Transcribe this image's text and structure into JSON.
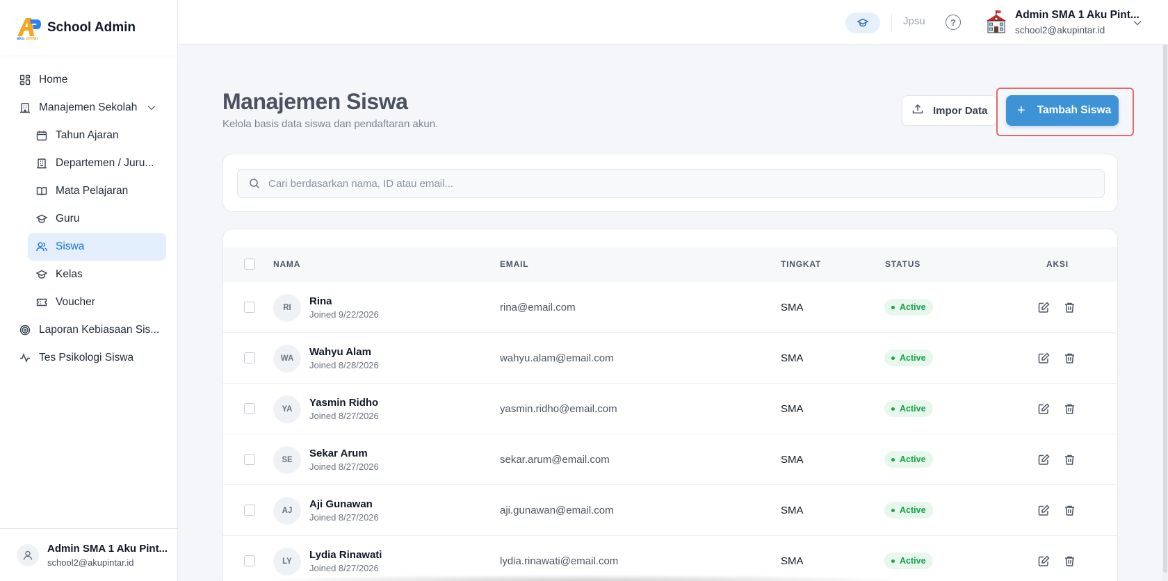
{
  "brand": {
    "title": "School Admin",
    "logo_text": "akupintar"
  },
  "sidebar": {
    "items": [
      {
        "label": "Home",
        "icon": "grid-icon",
        "level": "top"
      },
      {
        "label": "Manajemen Sekolah",
        "icon": "building-icon",
        "level": "top",
        "expandable": true
      },
      {
        "label": "Tahun Ajaran",
        "icon": "calendar-icon",
        "level": "sub"
      },
      {
        "label": "Departemen / Juru...",
        "icon": "department-icon",
        "level": "sub"
      },
      {
        "label": "Mata Pelajaran",
        "icon": "book-icon",
        "level": "sub"
      },
      {
        "label": "Guru",
        "icon": "graduation-cap-icon",
        "level": "sub"
      },
      {
        "label": "Siswa",
        "icon": "users-icon",
        "level": "sub",
        "active": true
      },
      {
        "label": "Kelas",
        "icon": "graduation-cap-icon",
        "level": "sub"
      },
      {
        "label": "Voucher",
        "icon": "ticket-icon",
        "level": "sub"
      },
      {
        "label": "Laporan Kebiasaan Sis...",
        "icon": "target-icon",
        "level": "top"
      },
      {
        "label": "Tes Psikologi Siswa",
        "icon": "activity-icon",
        "level": "top"
      }
    ],
    "footer": {
      "name": "Admin SMA 1 Aku Pint...",
      "email": "school2@akupintar.id"
    }
  },
  "topbar": {
    "language": "Jpsu",
    "help": "?",
    "user_name": "Admin SMA 1 Aku Pint...",
    "user_email": "school2@akupintar.id"
  },
  "main": {
    "title": "Manajemen Siswa",
    "subtitle": "Kelola basis data siswa dan pendaftaran akun.",
    "import_label": "Impor Data",
    "add_label": "Tambah Siswa",
    "search_placeholder": "Cari berdasarkan nama, ID atau email..."
  },
  "table": {
    "headers": {
      "name": "NAMA",
      "email": "EMAIL",
      "level": "TINGKAT",
      "status": "STATUS",
      "actions": "AKSI"
    },
    "rows": [
      {
        "initials": "RI",
        "name": "Rina",
        "joined": "Joined 9/22/2026",
        "email": "rina@email.com",
        "level": "SMA",
        "status": "Active"
      },
      {
        "initials": "WA",
        "name": "Wahyu Alam",
        "joined": "Joined 8/28/2026",
        "email": "wahyu.alam@email.com",
        "level": "SMA",
        "status": "Active"
      },
      {
        "initials": "YA",
        "name": "Yasmin Ridho",
        "joined": "Joined 8/27/2026",
        "email": "yasmin.ridho@email.com",
        "level": "SMA",
        "status": "Active"
      },
      {
        "initials": "SE",
        "name": "Sekar Arum",
        "joined": "Joined 8/27/2026",
        "email": "sekar.arum@email.com",
        "level": "SMA",
        "status": "Active"
      },
      {
        "initials": "AJ",
        "name": "Aji Gunawan",
        "joined": "Joined 8/27/2026",
        "email": "aji.gunawan@email.com",
        "level": "SMA",
        "status": "Active"
      },
      {
        "initials": "LY",
        "name": "Lydia Rinawati",
        "joined": "Joined 8/27/2026",
        "email": "lydia.rinawati@email.com",
        "level": "SMA",
        "status": "Active"
      }
    ]
  },
  "colors": {
    "accent": "#3e93d6",
    "active_nav": "#1e6ed8",
    "status_green": "#16a34a",
    "highlight": "#e26a6a"
  }
}
